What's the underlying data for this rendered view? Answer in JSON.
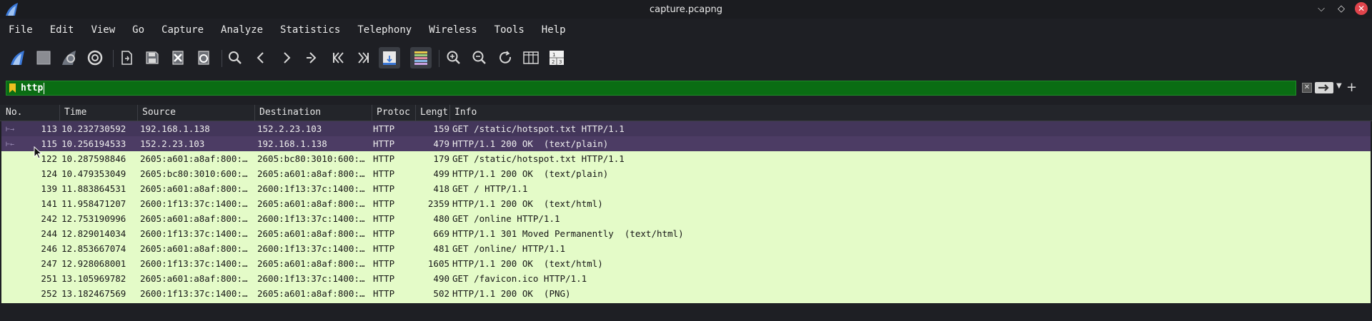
{
  "window": {
    "title": "capture.pcapng"
  },
  "menu": [
    "File",
    "Edit",
    "View",
    "Go",
    "Capture",
    "Analyze",
    "Statistics",
    "Telephony",
    "Wireless",
    "Tools",
    "Help"
  ],
  "toolbar": {
    "icons": [
      "start-capture-icon",
      "stop-capture-icon",
      "restart-capture-icon",
      "capture-options-icon",
      "open-file-icon",
      "save-file-icon",
      "close-file-icon",
      "reload-file-icon",
      "find-packet-icon",
      "go-back-icon",
      "go-forward-icon",
      "go-to-packet-icon",
      "first-packet-icon",
      "last-packet-icon",
      "auto-scroll-icon",
      "colorize-icon",
      "zoom-in-icon",
      "zoom-out-icon",
      "normal-size-icon",
      "resize-columns-icon",
      "layout-icon"
    ]
  },
  "filter": {
    "value": "http"
  },
  "columns": [
    "No.",
    "Time",
    "Source",
    "Destination",
    "Protoc",
    "Lengt",
    "Info"
  ],
  "packets": [
    {
      "no": "113",
      "time": "10.232730592",
      "src": "192.168.1.138",
      "dst": "152.2.23.103",
      "proto": "HTTP",
      "len": "159",
      "info": "GET /static/hotspot.txt HTTP/1.1"
    },
    {
      "no": "115",
      "time": "10.256194533",
      "src": "152.2.23.103",
      "dst": "192.168.1.138",
      "proto": "HTTP",
      "len": "479",
      "info": "HTTP/1.1 200 OK  (text/plain)"
    },
    {
      "no": "122",
      "time": "10.287598846",
      "src": "2605:a601:a8af:800:…",
      "dst": "2605:bc80:3010:600:…",
      "proto": "HTTP",
      "len": "179",
      "info": "GET /static/hotspot.txt HTTP/1.1"
    },
    {
      "no": "124",
      "time": "10.479353049",
      "src": "2605:bc80:3010:600:…",
      "dst": "2605:a601:a8af:800:…",
      "proto": "HTTP",
      "len": "499",
      "info": "HTTP/1.1 200 OK  (text/plain)"
    },
    {
      "no": "139",
      "time": "11.883864531",
      "src": "2605:a601:a8af:800:…",
      "dst": "2600:1f13:37c:1400:…",
      "proto": "HTTP",
      "len": "418",
      "info": "GET / HTTP/1.1"
    },
    {
      "no": "141",
      "time": "11.958471207",
      "src": "2600:1f13:37c:1400:…",
      "dst": "2605:a601:a8af:800:…",
      "proto": "HTTP",
      "len": "2359",
      "info": "HTTP/1.1 200 OK  (text/html)"
    },
    {
      "no": "242",
      "time": "12.753190996",
      "src": "2605:a601:a8af:800:…",
      "dst": "2600:1f13:37c:1400:…",
      "proto": "HTTP",
      "len": "480",
      "info": "GET /online HTTP/1.1"
    },
    {
      "no": "244",
      "time": "12.829014034",
      "src": "2600:1f13:37c:1400:…",
      "dst": "2605:a601:a8af:800:…",
      "proto": "HTTP",
      "len": "669",
      "info": "HTTP/1.1 301 Moved Permanently  (text/html)"
    },
    {
      "no": "246",
      "time": "12.853667074",
      "src": "2605:a601:a8af:800:…",
      "dst": "2600:1f13:37c:1400:…",
      "proto": "HTTP",
      "len": "481",
      "info": "GET /online/ HTTP/1.1"
    },
    {
      "no": "247",
      "time": "12.928068001",
      "src": "2600:1f13:37c:1400:…",
      "dst": "2605:a601:a8af:800:…",
      "proto": "HTTP",
      "len": "1605",
      "info": "HTTP/1.1 200 OK  (text/html)"
    },
    {
      "no": "251",
      "time": "13.105969782",
      "src": "2605:a601:a8af:800:…",
      "dst": "2600:1f13:37c:1400:…",
      "proto": "HTTP",
      "len": "490",
      "info": "GET /favicon.ico HTTP/1.1"
    },
    {
      "no": "252",
      "time": "13.182467569",
      "src": "2600:1f13:37c:1400:…",
      "dst": "2605:a601:a8af:800:…",
      "proto": "HTTP",
      "len": "502",
      "info": "HTTP/1.1 200 OK  (PNG)"
    }
  ],
  "colors": {
    "filter_valid": "#0a6d13",
    "row_http": "#e4fbc8",
    "row_selected": "#43365a"
  }
}
